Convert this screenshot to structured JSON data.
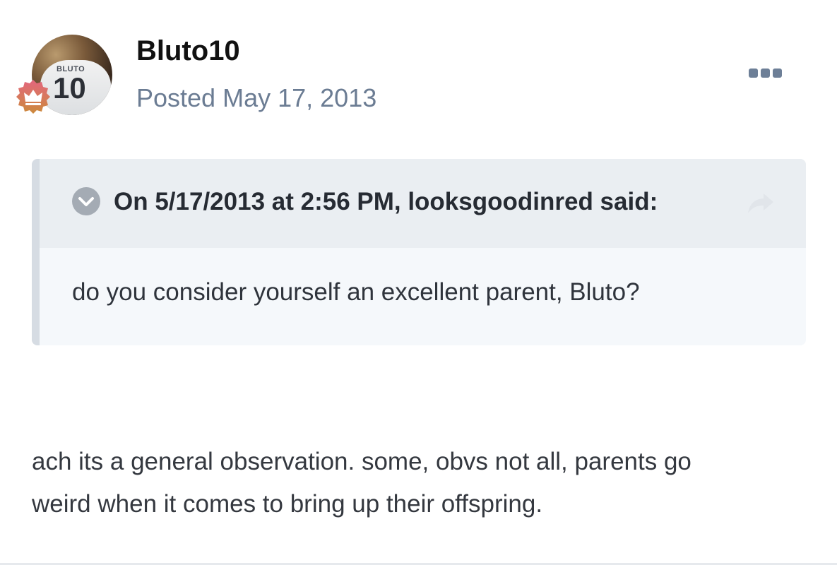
{
  "post": {
    "author": "Bluto10",
    "posted_prefix": "Posted",
    "posted_date": "May 17, 2013",
    "avatar_shirt_name": "BLUTO",
    "avatar_shirt_number": "10",
    "quote": {
      "citation": "On 5/17/2013 at 2:56 PM, looksgoodinred said:",
      "text": "do you consider yourself an excellent parent, Bluto?"
    },
    "content_line1": "ach its a general observation. some, obvs not all, parents go",
    "content_line2": "weird when it comes to bring up their offspring."
  },
  "icons": {
    "badge": "crown-badge-icon",
    "more": "ellipsis-menu-icon",
    "toggle": "chevron-down-circle-icon",
    "share": "share-arrow-icon"
  },
  "colors": {
    "author": "#111111",
    "meta": "#6b7c93",
    "quote_head_bg": "#eaeef2",
    "quote_body_bg": "#f5f8fb",
    "quote_bar": "#d6dce3",
    "badge_top": "#e36a7c",
    "badge_bottom": "#c98a3c"
  }
}
